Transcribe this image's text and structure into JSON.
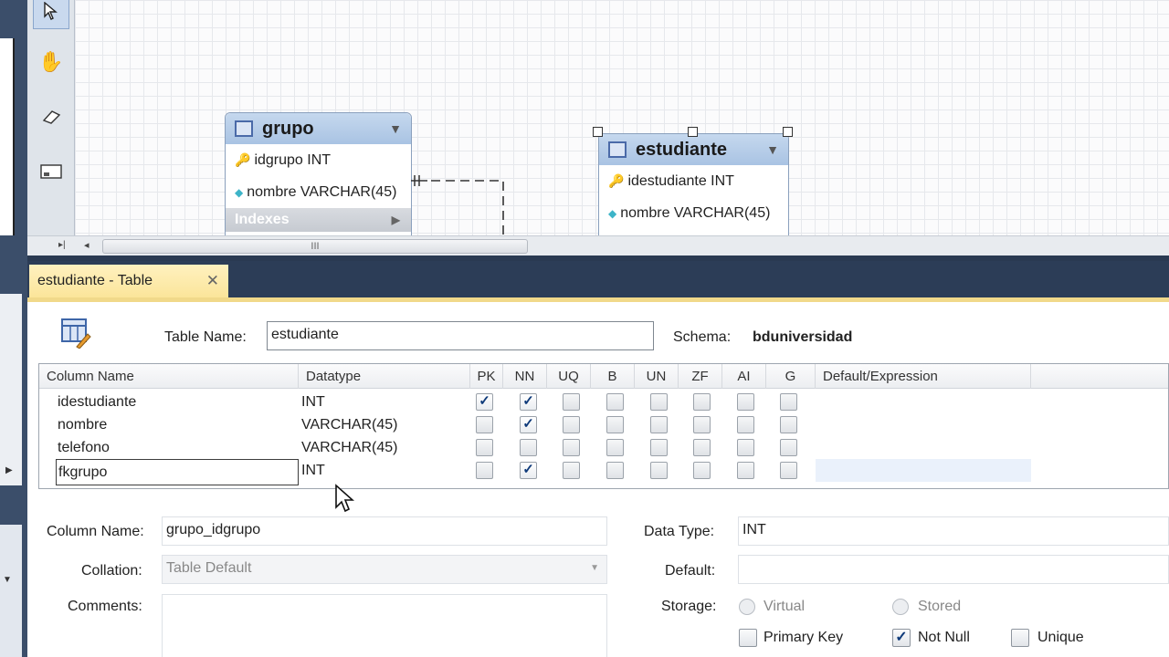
{
  "diagram": {
    "entities": [
      {
        "title": "grupo",
        "rows": [
          {
            "icon": "primary-key-icon",
            "text": "idgrupo INT"
          },
          {
            "icon": "column-diamond-icon",
            "text": "nombre VARCHAR(45)"
          }
        ],
        "indexes_label": "Indexes"
      },
      {
        "title": "estudiante",
        "rows": [
          {
            "icon": "primary-key-icon",
            "text": "idestudiante INT"
          },
          {
            "icon": "column-diamond-icon",
            "text": "nombre VARCHAR(45)"
          }
        ]
      }
    ],
    "scroll_grip": "III"
  },
  "editor": {
    "tab_label": "estudiante - Table",
    "tab_close": "✕",
    "table_name_label": "Table Name:",
    "table_name_value": "estudiante",
    "schema_label": "Schema:",
    "schema_value": "bduniversidad",
    "grid": {
      "headers": [
        "Column Name",
        "Datatype",
        "PK",
        "NN",
        "UQ",
        "B",
        "UN",
        "ZF",
        "AI",
        "G",
        "Default/Expression"
      ],
      "rows": [
        {
          "name": "idestudiante",
          "type": "INT",
          "flags": [
            true,
            true,
            false,
            false,
            false,
            false,
            false,
            false
          ]
        },
        {
          "name": "nombre",
          "type": "VARCHAR(45)",
          "flags": [
            false,
            true,
            false,
            false,
            false,
            false,
            false,
            false
          ]
        },
        {
          "name": "telefono",
          "type": "VARCHAR(45)",
          "flags": [
            false,
            false,
            false,
            false,
            false,
            false,
            false,
            false
          ]
        },
        {
          "name": "fkgrupo",
          "type": "INT",
          "flags": [
            false,
            true,
            false,
            false,
            false,
            false,
            false,
            false
          ]
        }
      ]
    },
    "details": {
      "column_name_label": "Column Name:",
      "column_name_value": "grupo_idgrupo",
      "data_type_label": "Data Type:",
      "data_type_value": "INT",
      "collation_label": "Collation:",
      "collation_value": "Table Default",
      "default_label": "Default:",
      "default_value": "",
      "comments_label": "Comments:",
      "storage_label": "Storage:",
      "virtual_label": "Virtual",
      "stored_label": "Stored",
      "primary_key_label": "Primary Key",
      "primary_key_checked": false,
      "not_null_label": "Not Null",
      "not_null_checked": true,
      "unique_label": "Unique",
      "unique_checked": false
    }
  },
  "colors": {
    "accent_tab": "#fbe59a",
    "frame": "#2c3d57",
    "entity_header": "#a9c3e3"
  }
}
